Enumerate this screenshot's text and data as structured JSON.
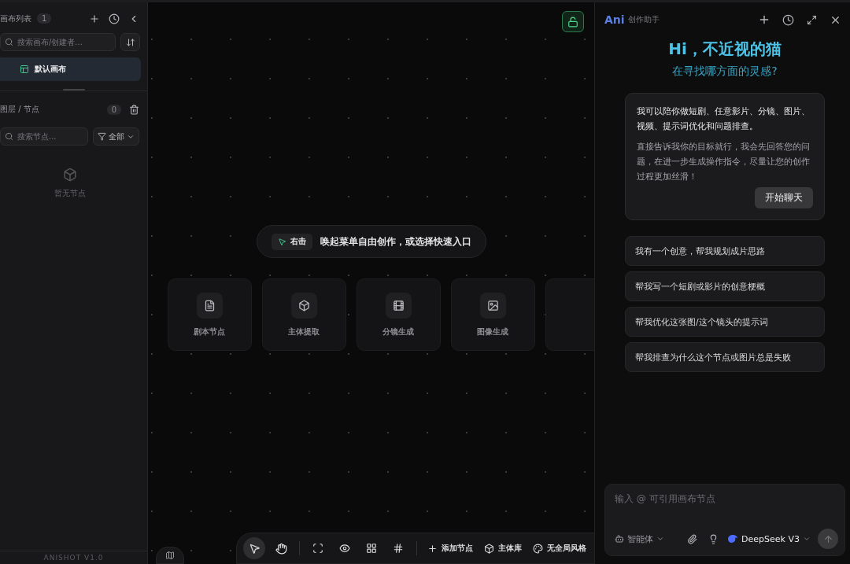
{
  "sidebar": {
    "canvas_list": {
      "title": "画布列表",
      "count": "1"
    },
    "canvas_search": {
      "placeholder": "搜索画布/创建者..."
    },
    "canvases": [
      {
        "name": "默认画布",
        "selected": true
      }
    ],
    "layers": {
      "title": "图层 / 节点",
      "count": "0"
    },
    "node_search": {
      "placeholder": "搜索节点..."
    },
    "filter": {
      "label": "全部"
    },
    "empty_text": "暂无节点",
    "version": "ANISHOT V1.0"
  },
  "canvas": {
    "hint": {
      "key_label": "右击",
      "text": "唤起菜单自由创作，或选择快速入口"
    },
    "quick_nodes": [
      {
        "label": "剧本节点"
      },
      {
        "label": "主体提取"
      },
      {
        "label": "分镜生成"
      },
      {
        "label": "图像生成"
      }
    ],
    "locked": false,
    "tools": [
      {
        "selected": true
      },
      {
        "selected": false
      }
    ],
    "actions": [
      {
        "label": "添加节点"
      },
      {
        "label": "主体库"
      },
      {
        "label": "无全局风格"
      }
    ]
  },
  "assistant": {
    "brand": "Ani",
    "title": "创作助手",
    "greeting": "Hi，不近视的猫",
    "subtitle": "在寻找哪方面的灵感?",
    "intro": {
      "lead": "我可以陪你做短剧、任意影片、分镜、图片、视频、提示词优化和问题排查。",
      "body": "直接告诉我你的目标就行，我会先回答您的问题，在进一步生成操作指令，尽量让您的创作过程更加丝滑！",
      "button": "开始聊天"
    },
    "suggestions": [
      "我有一个创意，帮我规划成片思路",
      "帮我写一个短剧或影片的创意梗概",
      "帮我优化这张图/这个镜头的提示词",
      "帮我排查为什么这个节点或图片总是失败"
    ],
    "input": {
      "placeholder": "输入 @ 可引用画布节点"
    },
    "agent": "智能体",
    "model": "DeepSeek V3"
  }
}
